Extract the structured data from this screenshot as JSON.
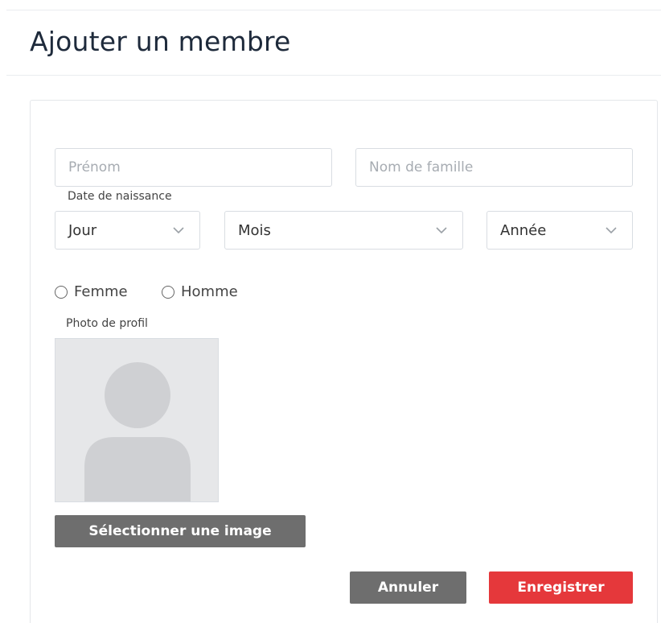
{
  "page": {
    "title": "Ajouter un membre"
  },
  "form": {
    "first_name": {
      "placeholder": "Prénom",
      "value": ""
    },
    "last_name": {
      "placeholder": "Nom de famille",
      "value": ""
    },
    "date_of_birth": {
      "label": "Date de naissance",
      "day": {
        "selected": "Jour",
        "icon": "chevron-down-icon"
      },
      "month": {
        "selected": "Mois",
        "icon": "chevron-down-icon"
      },
      "year": {
        "selected": "Année",
        "icon": "chevron-down-icon"
      }
    },
    "gender": {
      "options": [
        {
          "label": "Femme",
          "checked": false
        },
        {
          "label": "Homme",
          "checked": false
        }
      ]
    },
    "profile_photo": {
      "label": "Photo de profil",
      "placeholder_icon": "avatar-placeholder-icon",
      "select_button_label": "Sélectionner une image"
    },
    "actions": {
      "cancel_label": "Annuler",
      "save_label": "Enregistrer"
    }
  },
  "colors": {
    "primary_button": "#e5383b",
    "secondary_button": "#6e6e6e",
    "title_text": "#1e2a3b",
    "avatar_bg": "#e6e7e9",
    "avatar_silhouette": "#cfd0d3"
  }
}
